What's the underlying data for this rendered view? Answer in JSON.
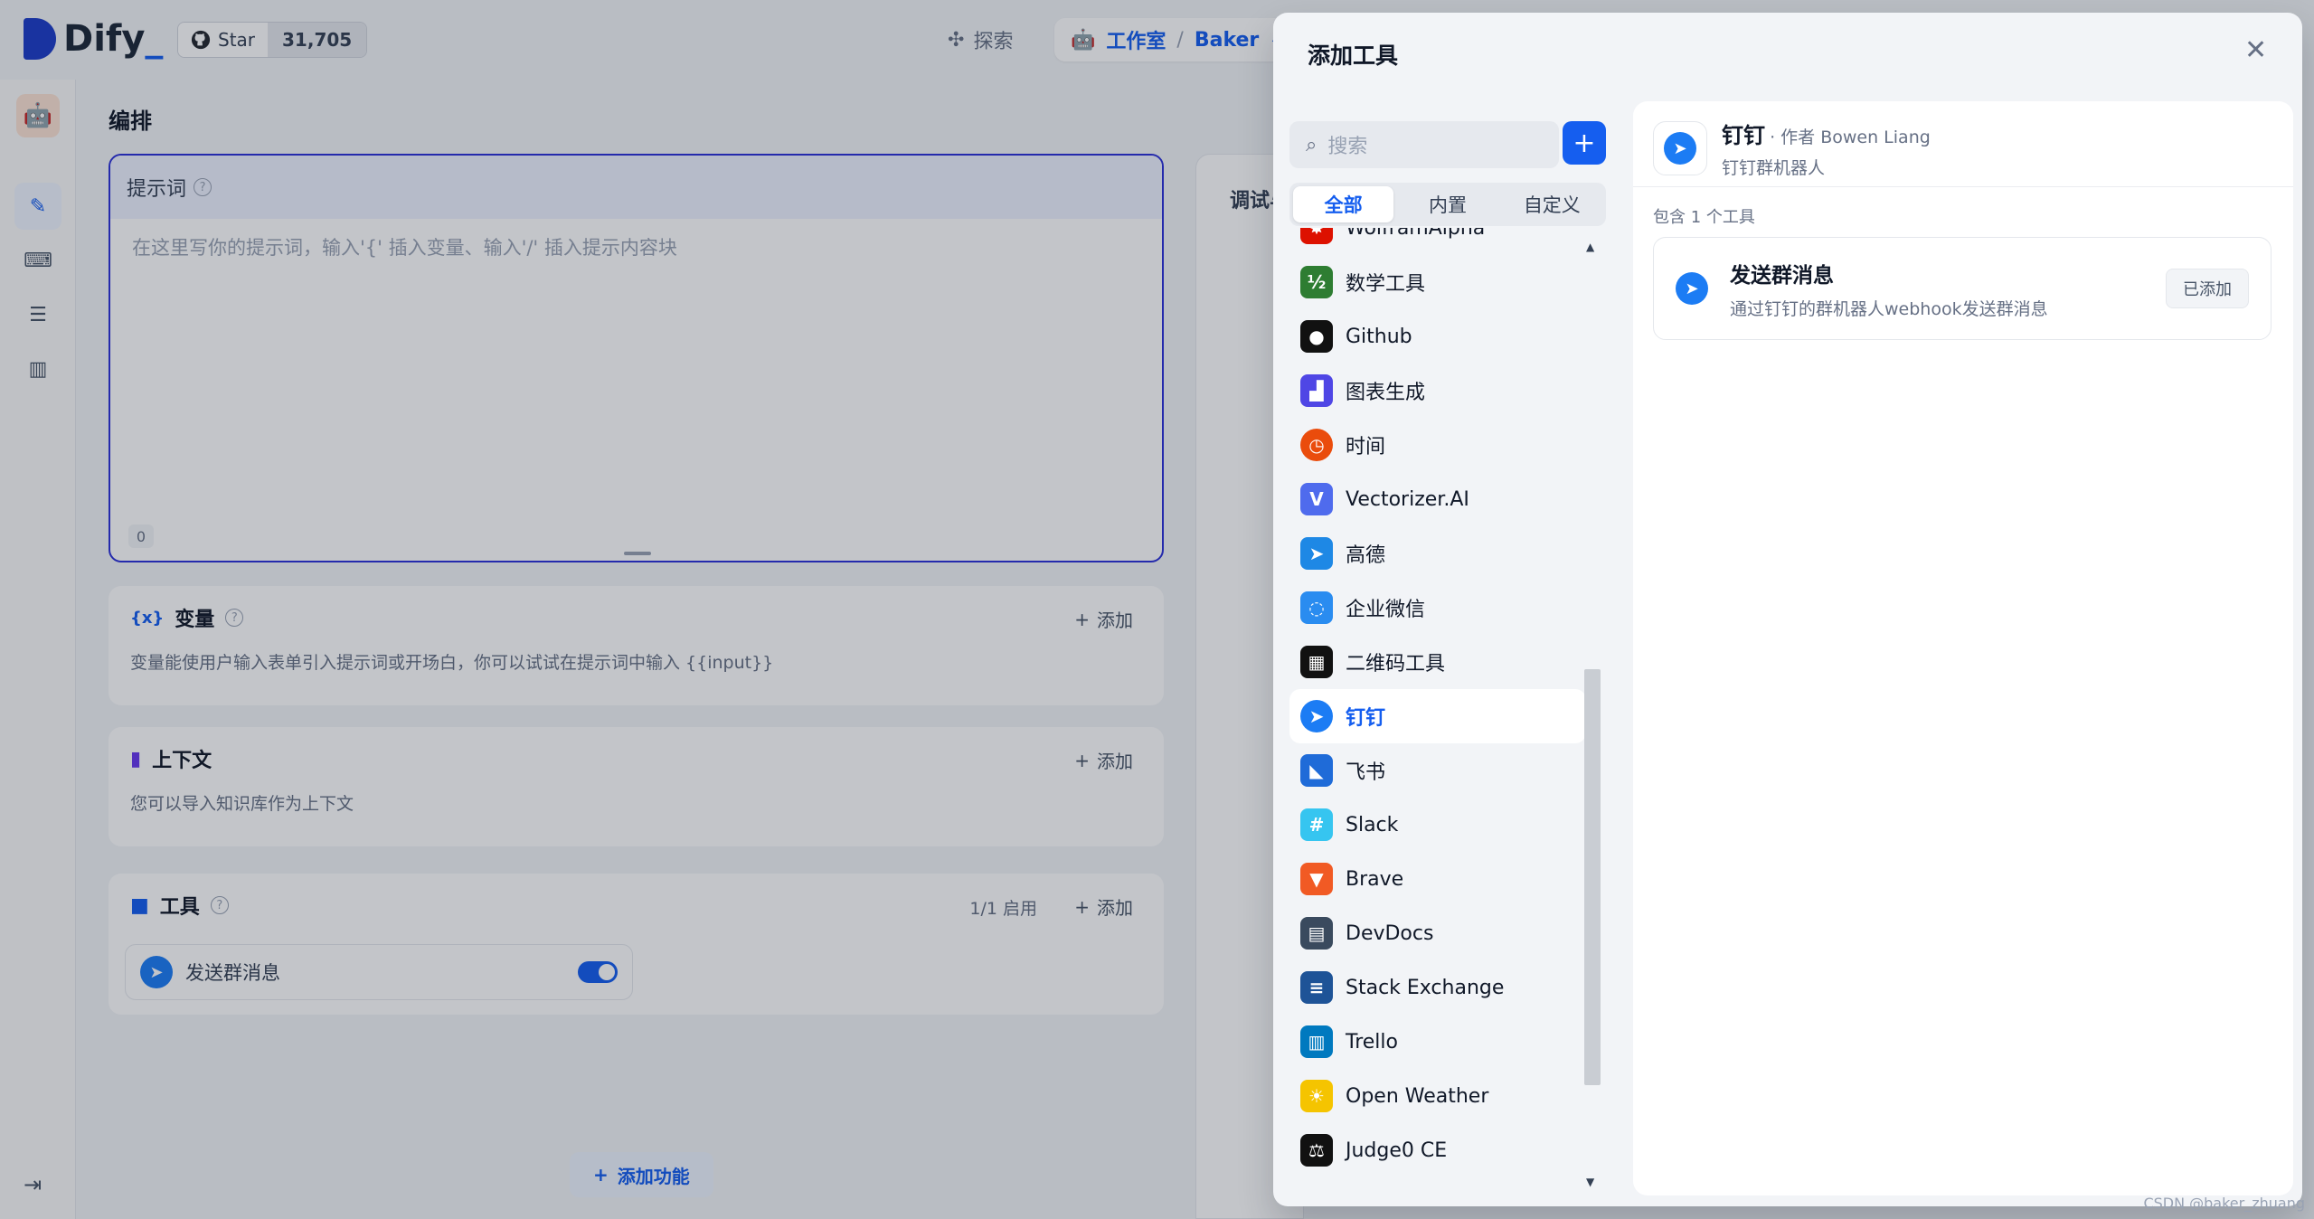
{
  "app": {
    "logo_text": "Dify",
    "github_star_label": "Star",
    "github_star_count": "31,705",
    "explore_label": "探索",
    "studio_label": "工作室",
    "app_name": "Baker",
    "accent": "#155eef"
  },
  "editor": {
    "section_title": "编排",
    "prompt_label": "提示词",
    "prompt_placeholder": "在这里写你的提示词，输入'{' 插入变量、输入'/' 插入提示内容块",
    "prompt_char_count": "0",
    "variables": {
      "title": "变量",
      "add_label": "添加",
      "description": "变量能使用户输入表单引入提示词或开场白，你可以试试在提示词中输入 {{input}}"
    },
    "context": {
      "title": "上下文",
      "add_label": "添加",
      "description": "您可以导入知识库作为上下文"
    },
    "tools": {
      "title": "工具",
      "status": "1/1 启用",
      "add_label": "添加",
      "item_label": "发送群消息"
    },
    "add_feature_label": "添加功能",
    "debug_title": "调试与预览"
  },
  "drawer": {
    "title": "添加工具",
    "search_placeholder": "搜索",
    "tabs": [
      "全部",
      "内置",
      "自定义"
    ],
    "tools": [
      {
        "name": "WolframAlpha",
        "icon": "wolfram-icon",
        "color": "#dd1100"
      },
      {
        "name": "数学工具",
        "icon": "math-icon",
        "color": "#2e7d32"
      },
      {
        "name": "Github",
        "icon": "github-icon",
        "color": "#111111"
      },
      {
        "name": "图表生成",
        "icon": "chart-icon",
        "color": "#4f46e5"
      },
      {
        "name": "时间",
        "icon": "clock-icon",
        "color": "#ea4c0c"
      },
      {
        "name": "Vectorizer.AI",
        "icon": "vectorizer-icon",
        "color": "#4f6bed"
      },
      {
        "name": "高德",
        "icon": "amap-icon",
        "color": "#1e88e5"
      },
      {
        "name": "企业微信",
        "icon": "wecom-icon",
        "color": "#2a8cf0"
      },
      {
        "name": "二维码工具",
        "icon": "qrcode-icon",
        "color": "#111111"
      },
      {
        "name": "钉钉",
        "icon": "dingtalk-icon",
        "color": "#1c7cf4"
      },
      {
        "name": "飞书",
        "icon": "feishu-icon",
        "color": "#1f6bd8"
      },
      {
        "name": "Slack",
        "icon": "slack-icon",
        "color": "#36c5f0"
      },
      {
        "name": "Brave",
        "icon": "brave-icon",
        "color": "#f15a24"
      },
      {
        "name": "DevDocs",
        "icon": "devdocs-icon",
        "color": "#3a4a5e"
      },
      {
        "name": "Stack Exchange",
        "icon": "stackexchange-icon",
        "color": "#1e5397"
      },
      {
        "name": "Trello",
        "icon": "trello-icon",
        "color": "#0079bf"
      },
      {
        "name": "Open Weather",
        "icon": "weather-icon",
        "color": "#f5c400"
      },
      {
        "name": "Judge0 CE",
        "icon": "judge0-icon",
        "color": "#111111"
      }
    ],
    "selected_tool": "钉钉",
    "detail": {
      "name": "钉钉",
      "author": "· 作者 Bowen Liang",
      "description": "钉钉群机器人",
      "count_label": "包含 1 个工具",
      "tool_name": "发送群消息",
      "tool_description": "通过钉钉的群机器人webhook发送群消息",
      "added_label": "已添加"
    }
  },
  "watermark": "CSDN @baker_zhuang"
}
